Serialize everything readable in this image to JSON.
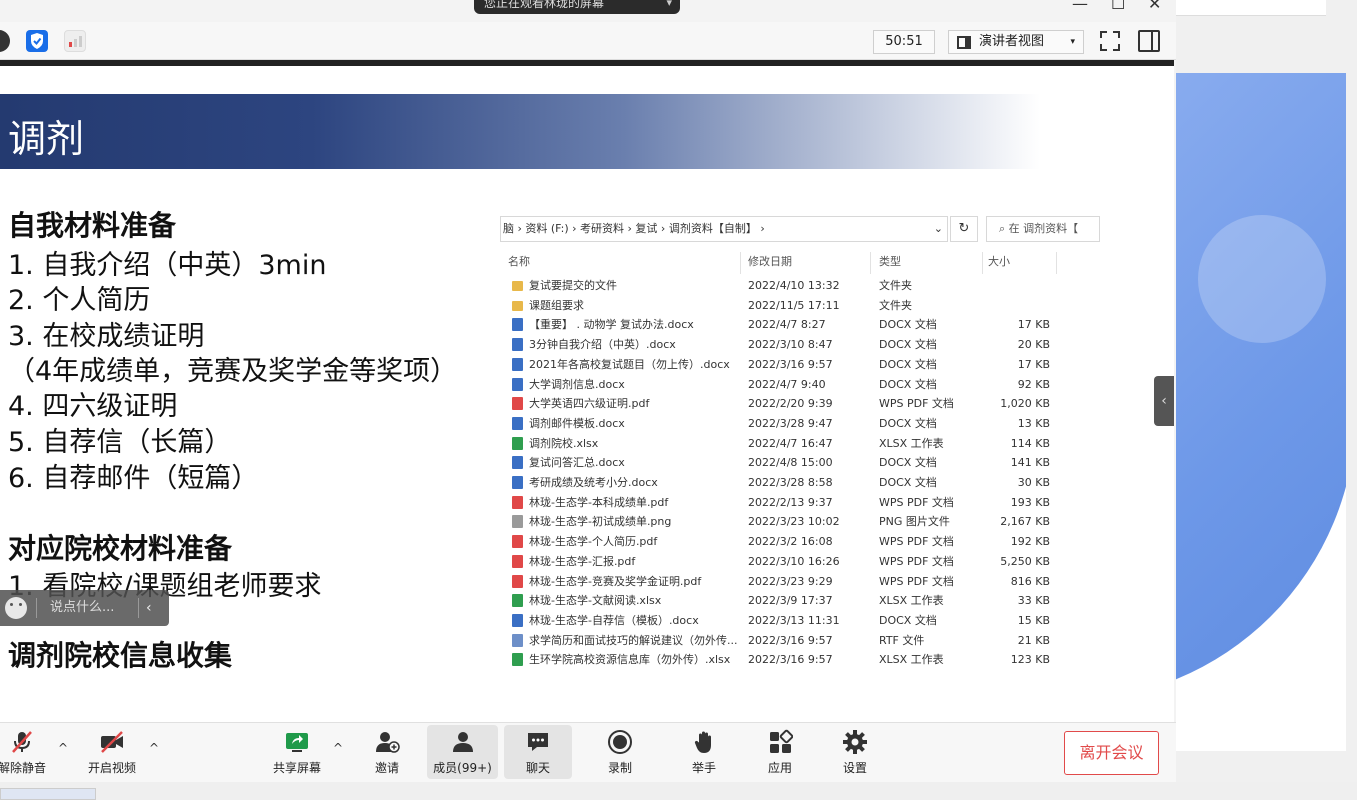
{
  "share_banner": {
    "text": "您正在观看林珑的屏幕",
    "caret": "▾"
  },
  "toolbar": {
    "timer": "50:51",
    "view_label": "演讲者视图",
    "view_caret": "▾"
  },
  "slide": {
    "title": "调剂",
    "section1_heading": "自我材料准备",
    "section1_items": [
      "1.   自我介绍（中英）3min",
      "2.   个人简历",
      "3.   在校成绩证明",
      "（4年成绩单，竞赛及奖学金等奖项）",
      "4.    四六级证明",
      "5.    自荐信（长篇）",
      "6.    自荐邮件（短篇）"
    ],
    "section2_heading": "对应院校材料准备",
    "section2_items": [
      "1.   看院校/课题组老师要求"
    ],
    "section3_heading": "调剂院校信息收集"
  },
  "explorer": {
    "address": "脑  ›  资料 (F:)  ›  考研资料  ›  复试  ›  调剂资料【自制】  ›",
    "address_chevron": "⌄",
    "refresh": "↻",
    "search_placeholder": "⌕  在 调剂资料【",
    "columns": {
      "name": "名称",
      "date": "修改日期",
      "type": "类型",
      "size": "大小"
    },
    "files": [
      {
        "name": "复试要提交的文件",
        "date": "2022/4/10 13:32",
        "type": "文件夹",
        "size": "",
        "icon": "folder",
        "color": "#e8b84a"
      },
      {
        "name": "课题组要求",
        "date": "2022/11/5 17:11",
        "type": "文件夹",
        "size": "",
        "icon": "folder",
        "color": "#e8b84a"
      },
      {
        "name": "【重要】        . 动物学 复试办法.docx",
        "date": "2022/4/7 8:27",
        "type": "DOCX 文档",
        "size": "17 KB",
        "icon": "docx",
        "color": "#3a6fc4"
      },
      {
        "name": "3分钟自我介绍（中英）.docx",
        "date": "2022/3/10 8:47",
        "type": "DOCX 文档",
        "size": "20 KB",
        "icon": "docx",
        "color": "#3a6fc4"
      },
      {
        "name": "2021年各高校复试题目（勿上传）.docx",
        "date": "2022/3/16 9:57",
        "type": "DOCX 文档",
        "size": "17 KB",
        "icon": "docx",
        "color": "#3a6fc4"
      },
      {
        "name": "大学调剂信息.docx",
        "date": "2022/4/7 9:40",
        "type": "DOCX 文档",
        "size": "92 KB",
        "icon": "docx",
        "color": "#3a6fc4"
      },
      {
        "name": "大学英语四六级证明.pdf",
        "date": "2022/2/20 9:39",
        "type": "WPS PDF 文档",
        "size": "1,020 KB",
        "icon": "pdf",
        "color": "#e04848"
      },
      {
        "name": "调剂邮件模板.docx",
        "date": "2022/3/28 9:47",
        "type": "DOCX 文档",
        "size": "13 KB",
        "icon": "docx",
        "color": "#3a6fc4"
      },
      {
        "name": "调剂院校.xlsx",
        "date": "2022/4/7 16:47",
        "type": "XLSX 工作表",
        "size": "114 KB",
        "icon": "xlsx",
        "color": "#2f9e4f"
      },
      {
        "name": "复试问答汇总.docx",
        "date": "2022/4/8 15:00",
        "type": "DOCX 文档",
        "size": "141 KB",
        "icon": "docx",
        "color": "#3a6fc4"
      },
      {
        "name": "考研成绩及统考小分.docx",
        "date": "2022/3/28 8:58",
        "type": "DOCX 文档",
        "size": "30 KB",
        "icon": "docx",
        "color": "#3a6fc4"
      },
      {
        "name": "林珑-生态学-本科成绩单.pdf",
        "date": "2022/2/13 9:37",
        "type": "WPS PDF 文档",
        "size": "193 KB",
        "icon": "pdf",
        "color": "#e04848"
      },
      {
        "name": "林珑-生态学-初试成绩单.png",
        "date": "2022/3/23 10:02",
        "type": "PNG 图片文件",
        "size": "2,167 KB",
        "icon": "png",
        "color": "#9a9a9a"
      },
      {
        "name": "林珑-生态学-个人简历.pdf",
        "date": "2022/3/2 16:08",
        "type": "WPS PDF 文档",
        "size": "192 KB",
        "icon": "pdf",
        "color": "#e04848"
      },
      {
        "name": "林珑-生态学-汇报.pdf",
        "date": "2022/3/10 16:26",
        "type": "WPS PDF 文档",
        "size": "5,250 KB",
        "icon": "pdf",
        "color": "#e04848"
      },
      {
        "name": "林珑-生态学-竞赛及奖学金证明.pdf",
        "date": "2022/3/23 9:29",
        "type": "WPS PDF 文档",
        "size": "816 KB",
        "icon": "pdf",
        "color": "#e04848"
      },
      {
        "name": "林珑-生态学-文献阅读.xlsx",
        "date": "2022/3/9 17:37",
        "type": "XLSX 工作表",
        "size": "33 KB",
        "icon": "xlsx",
        "color": "#2f9e4f"
      },
      {
        "name": "林珑-生态学-自荐信（模板）.docx",
        "date": "2022/3/13 11:31",
        "type": "DOCX 文档",
        "size": "15 KB",
        "icon": "docx",
        "color": "#3a6fc4"
      },
      {
        "name": "求学简历和面试技巧的解说建议（勿外传...",
        "date": "2022/3/16 9:57",
        "type": "RTF 文件",
        "size": "21 KB",
        "icon": "rtf",
        "color": "#6d8fc8"
      },
      {
        "name": "生环学院高校资源信息库（勿外传）.xlsx",
        "date": "2022/3/16 9:57",
        "type": "XLSX 工作表",
        "size": "123 KB",
        "icon": "xlsx",
        "color": "#2f9e4f"
      }
    ]
  },
  "chat": {
    "placeholder": "说点什么...",
    "collapse": "‹"
  },
  "side_collapse": "‹",
  "bottombar": {
    "unmute": "解除静音",
    "video": "开启视频",
    "share": "共享屏幕",
    "invite": "邀请",
    "members": "成员(99+)",
    "chat": "聊天",
    "record": "录制",
    "raise_hand": "举手",
    "apps": "应用",
    "settings": "设置",
    "leave": "离开会议",
    "caret": "^"
  },
  "window_controls": {
    "minimize": "—",
    "maximize": "☐",
    "close": "✕"
  },
  "colors": {
    "accent_red": "#e14a4a",
    "title_band": "#243a70",
    "panel_blue": "#6d98e8"
  }
}
